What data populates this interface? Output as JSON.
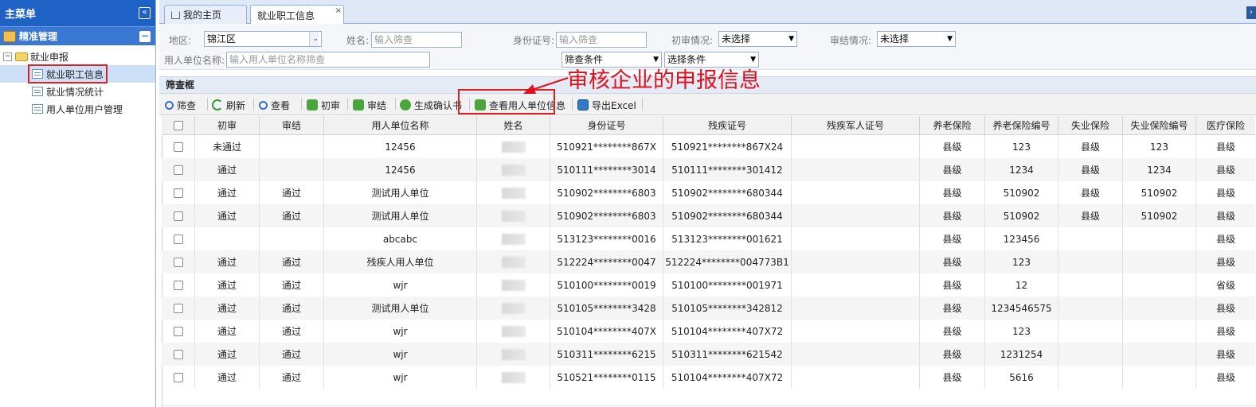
{
  "left_panel": {
    "title": "主菜单",
    "collapse_icon": "double-chevron-left-icon",
    "section_title": "精准管理",
    "tree": {
      "root_label": "就业申报",
      "items": [
        {
          "label": "就业职工信息",
          "selected": true
        },
        {
          "label": "就业情况统计",
          "selected": false
        },
        {
          "label": "用人单位用户管理",
          "selected": false
        }
      ]
    }
  },
  "tabs": [
    {
      "label": "我的主页",
      "icon": "home-icon"
    },
    {
      "label": "就业职工信息",
      "active": true
    }
  ],
  "filters": {
    "region_label": "地区:",
    "region_value": "锦江区",
    "name_label": "姓名:",
    "name_placeholder": "输入筛查",
    "id_label": "身份证号:",
    "id_placeholder": "输入筛查",
    "first_review_label": "初审情况:",
    "first_review_value": "未选择",
    "final_review_label": "审结情况:",
    "final_review_value": "未选择",
    "employer_label": "用人单位名称:",
    "employer_placeholder": "输入用人单位名称筛查",
    "condition_select": "筛查条件",
    "option_select": "选择条件"
  },
  "panel_title": "筛查框",
  "toolbar": {
    "filter": "筛查",
    "refresh": "刷新",
    "view": "查看",
    "first_review": "初审",
    "final_review": "审结",
    "generate_confirmation": "生成确认书",
    "view_employer": "查看用人单位信息",
    "export_excel": "导出Excel"
  },
  "annotation": "审核企业的申报信息",
  "grid": {
    "headers": [
      "初审",
      "审结",
      "用人单位名称",
      "姓名",
      "身份证号",
      "残疾证号",
      "残疾军人证号",
      "养老保险",
      "养老保险编号",
      "失业保险",
      "失业保险编号",
      "医疗保险"
    ],
    "rows": [
      [
        "未通过",
        "",
        "12456",
        "",
        "510921********867X",
        "510921********867X24",
        "",
        "县级",
        "123",
        "县级",
        "123",
        "县级"
      ],
      [
        "通过",
        "",
        "12456",
        "",
        "510111********3014",
        "510111********301412",
        "",
        "县级",
        "1234",
        "县级",
        "1234",
        "县级"
      ],
      [
        "通过",
        "通过",
        "测试用人单位",
        "",
        "510902********6803",
        "510902********680344",
        "",
        "县级",
        "510902",
        "县级",
        "510902",
        "县级"
      ],
      [
        "通过",
        "通过",
        "测试用人单位",
        "",
        "510902********6803",
        "510902********680344",
        "",
        "县级",
        "510902",
        "县级",
        "510902",
        "县级"
      ],
      [
        "",
        "",
        "abcabc",
        "",
        "513123********0016",
        "513123********001621",
        "",
        "县级",
        "123456",
        "",
        "",
        "县级"
      ],
      [
        "通过",
        "通过",
        "残疾人用人单位",
        "",
        "512224********0047",
        "512224********004773B1",
        "",
        "县级",
        "123",
        "",
        "",
        "县级"
      ],
      [
        "通过",
        "通过",
        "wjr",
        "",
        "510100********0019",
        "510100********001971",
        "",
        "县级",
        "12",
        "",
        "",
        "省级"
      ],
      [
        "通过",
        "通过",
        "测试用人单位",
        "",
        "510105********3428",
        "510105********342812",
        "",
        "县级",
        "1234546575",
        "",
        "",
        "县级"
      ],
      [
        "通过",
        "通过",
        "wjr",
        "",
        "510104********407X",
        "510104********407X72",
        "",
        "县级",
        "123",
        "",
        "",
        "县级"
      ],
      [
        "通过",
        "通过",
        "wjr",
        "",
        "510311********6215",
        "510311********621542",
        "",
        "县级",
        "1231254",
        "",
        "",
        "县级"
      ],
      [
        "通过",
        "通过",
        "wjr",
        "",
        "510521********0115",
        "510104********407X72",
        "",
        "县级",
        "5616",
        "",
        "",
        "县级"
      ]
    ]
  },
  "colors": {
    "header_blue": "#1f62c6",
    "annotation_red": "#e0101e",
    "icon_green": "#4aa63c"
  }
}
